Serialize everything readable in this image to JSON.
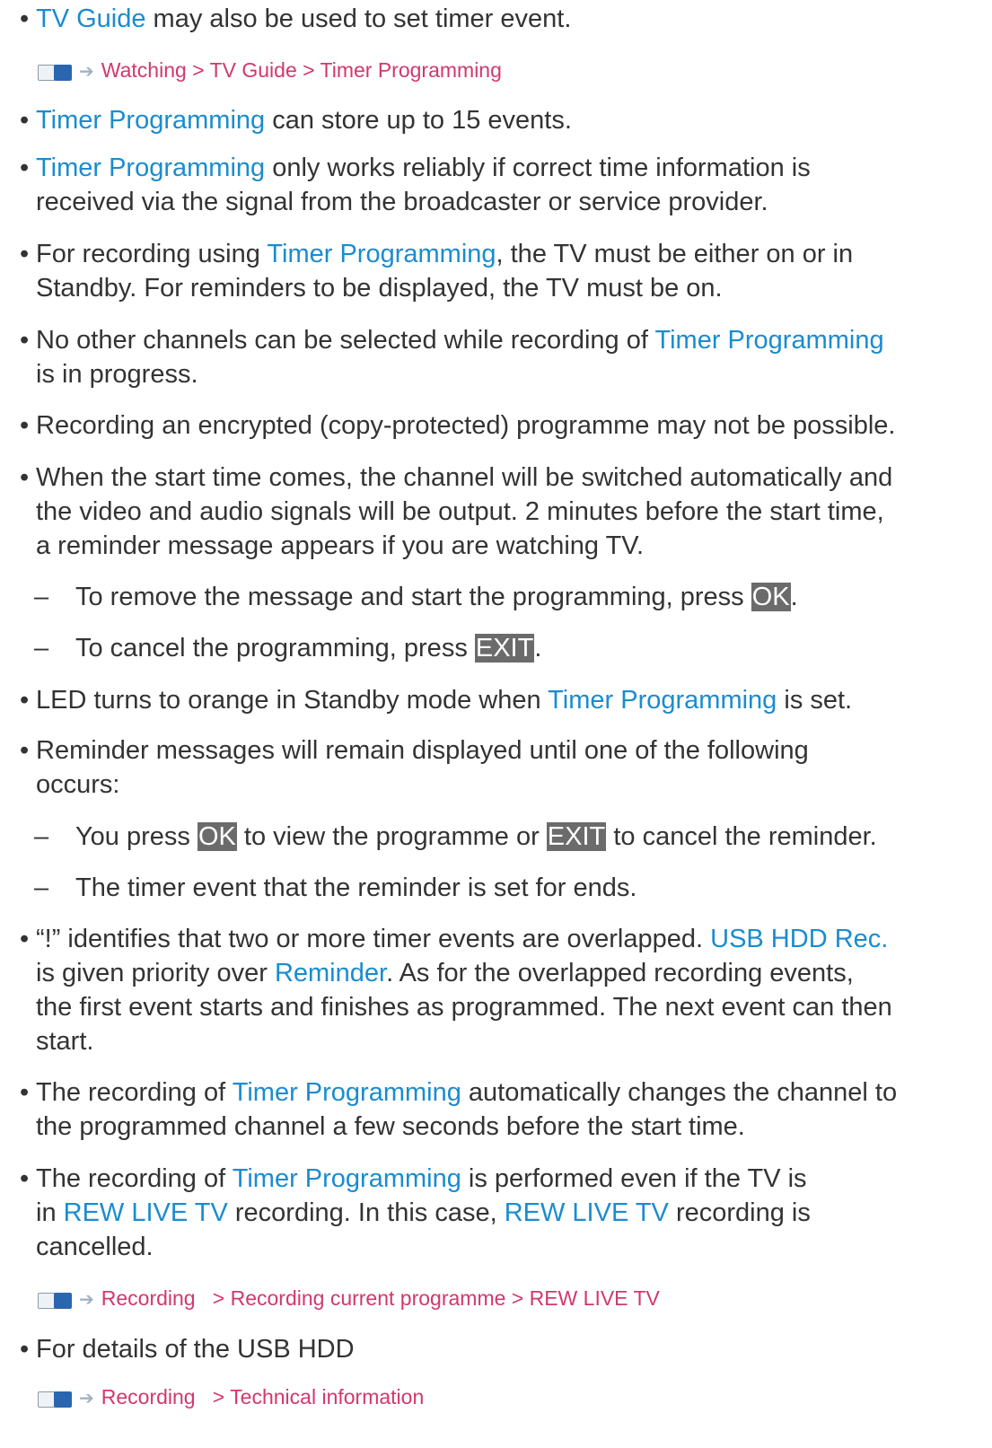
{
  "bullet": "•",
  "dash": "–",
  "ref_arrow": "➔",
  "items": [
    {
      "link": "TV Guide",
      "text": " may also be used to set timer event."
    },
    {
      "ref": "Watching > TV Guide > Timer Programming"
    },
    {
      "link": "Timer Programming",
      "text": " can store up to 15 events."
    },
    {
      "link": "Timer Programming",
      "l1": " only works reliably if correct time information is",
      "l2": "received via the signal from the broadcaster or service provider."
    },
    {
      "pre": "For recording using ",
      "link": "Timer Programming",
      "post": ", the TV must be either on or in",
      "l2": "Standby. For reminders to be displayed, the TV must be on."
    },
    {
      "pre": "No other channels can be selected while recording of ",
      "link": "Timer Programming",
      "l2": "is in progress."
    },
    {
      "text": "Recording an encrypted (copy-protected) programme may not be possible."
    },
    {
      "l1": "When the start time comes, the channel will be switched automatically and",
      "l2": "the video and audio signals will be output. 2 minutes before the start time,",
      "l3": "a reminder message appears if you are watching TV."
    },
    {
      "pre": "To remove the message and start the programming, press ",
      "key": "OK",
      "post": "."
    },
    {
      "pre": "To cancel the programming, press ",
      "key": "EXIT",
      "post": "."
    },
    {
      "pre": "LED turns to orange in Standby mode when ",
      "link": "Timer Programming",
      "post": " is set."
    },
    {
      "l1": "Reminder messages will remain displayed until one of the following",
      "l2": "occurs:"
    },
    {
      "pre": "You press ",
      "key1": "OK",
      "mid": " to view the programme or ",
      "key2": "EXIT",
      "post": " to cancel the reminder."
    },
    {
      "text": "The timer event that the reminder is set for ends."
    },
    {
      "pre": "“!” identifies that two or more timer events are overlapped. ",
      "link1": "USB HDD Rec.",
      "l2pre": "is given priority over ",
      "link2": "Reminder",
      "l2post": ". As for the overlapped recording events,",
      "l3": "the first event starts and finishes as programmed. The next event can then",
      "l4": "start."
    },
    {
      "pre": "The recording of ",
      "link": "Timer Programming",
      "post": " automatically changes the channel to",
      "l2": "the programmed channel a few seconds before the start time."
    },
    {
      "pre": "The recording of ",
      "link": "Timer Programming",
      "post": " is performed even if the TV is",
      "l2pre": "in ",
      "link2": "REW LIVE TV",
      "l2mid": " recording. In this case, ",
      "link3": "REW LIVE TV",
      "l2post": " recording is",
      "l3": "cancelled."
    },
    {
      "ref": "Recording   > Recording current programme > REW LIVE TV"
    },
    {
      "text": "For details of the USB HDD"
    },
    {
      "ref": "Recording   > Technical information"
    }
  ]
}
